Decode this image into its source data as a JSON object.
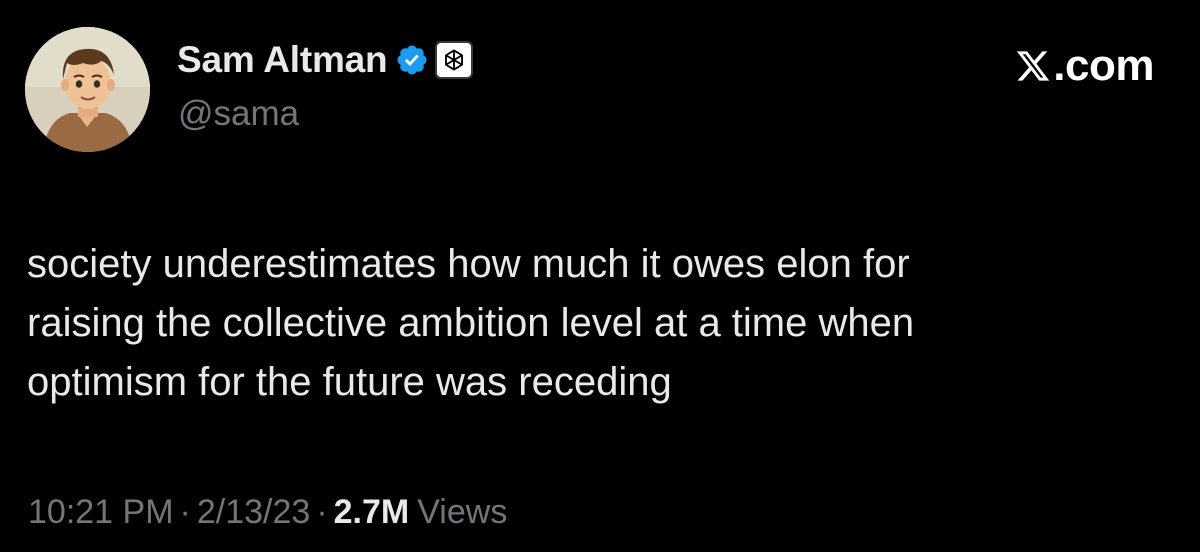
{
  "author": {
    "display_name": "Sam Altman",
    "handle": "@sama",
    "verified_icon": "verified-badge-icon",
    "affiliation_icon": "openai-logo-icon"
  },
  "brand": {
    "icon": "x-logo-icon",
    "text": ".com"
  },
  "tweet": {
    "text": "society underestimates how much it owes elon for\nraising the collective ambition level at a time when\noptimism for the future was receding"
  },
  "meta": {
    "time": "10:21 PM",
    "separator_1": "·",
    "date": "2/13/23",
    "separator_2": "·",
    "views_count": "2.7M",
    "views_label": "Views"
  },
  "colors": {
    "background": "#000000",
    "primary_text": "#e7e9ea",
    "secondary_text": "#71767b",
    "verified_blue": "#1d9bf0"
  }
}
